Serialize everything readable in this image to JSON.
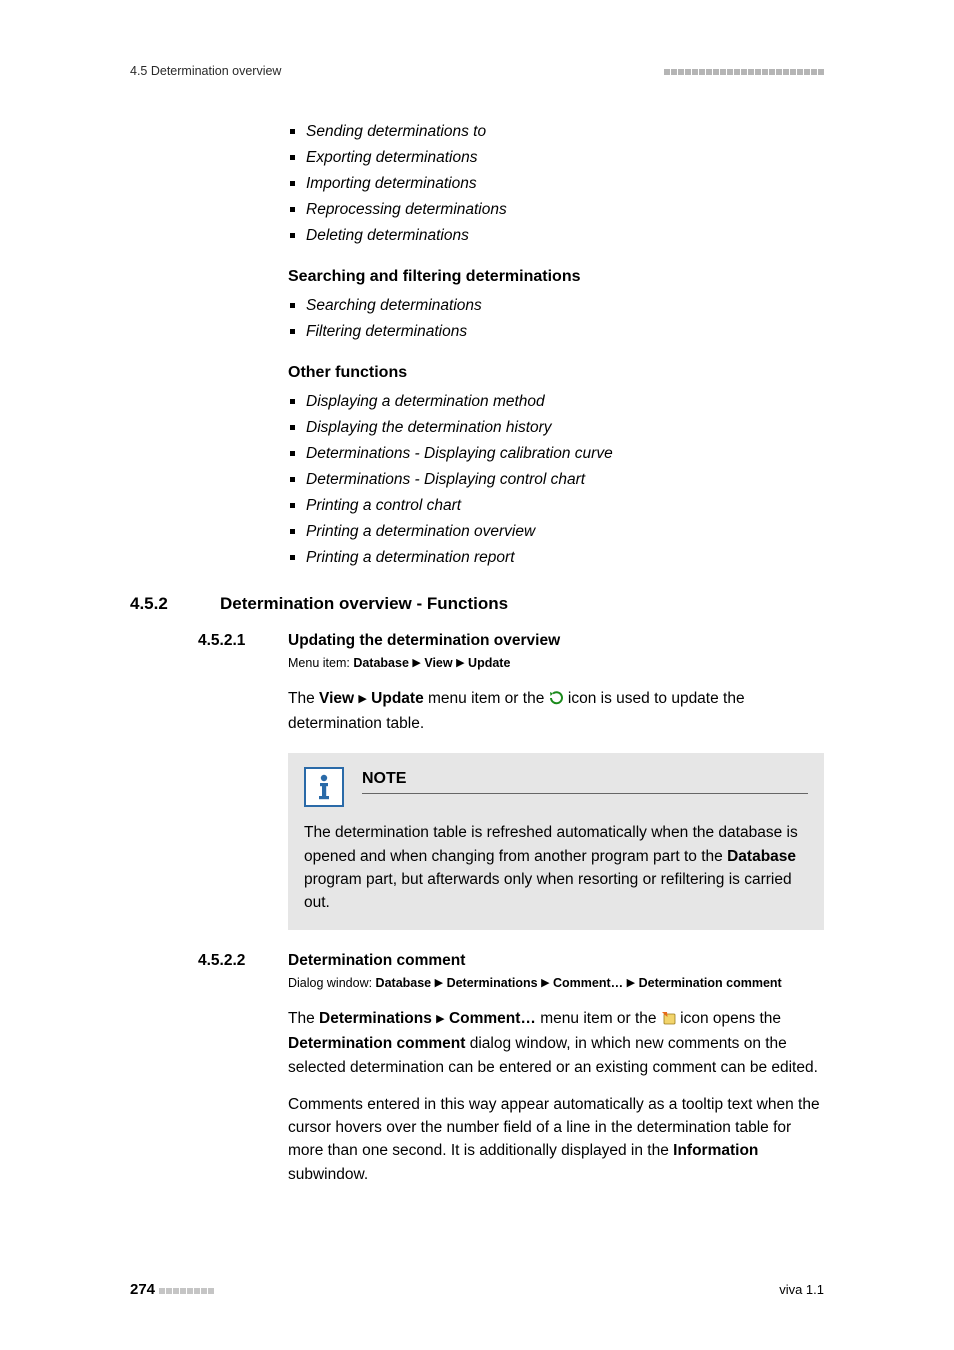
{
  "header": {
    "breadcrumb": "4.5 Determination overview"
  },
  "lists": {
    "first": [
      "Sending determinations to",
      "Exporting determinations",
      "Importing determinations",
      "Reprocessing determinations",
      "Deleting determinations"
    ],
    "search_heading": "Searching and filtering determinations",
    "search": [
      "Searching determinations",
      "Filtering determinations"
    ],
    "other_heading": "Other functions",
    "other": [
      "Displaying a determination method",
      "Displaying the determination history",
      "Determinations - Displaying calibration curve",
      "Determinations - Displaying control chart",
      "Printing a control chart",
      "Printing a determination overview",
      "Printing a determination report"
    ]
  },
  "sec": {
    "num": "4.5.2",
    "title": "Determination overview - Functions"
  },
  "sub1": {
    "num": "4.5.2.1",
    "title": "Updating the determination overview",
    "menu_prefix": "Menu item: ",
    "menu_1": "Database",
    "menu_2": "View",
    "menu_3": "Update",
    "p1_a": "The ",
    "p1_b": "View",
    "p1_c": "Update",
    "p1_d": " menu item or the ",
    "p1_e": " icon is used to update the determination table.",
    "note_label": "NOTE",
    "note_a": "The determination table is refreshed automatically when the database is opened and when changing from another program part to the ",
    "note_b": "Database",
    "note_c": " program part, but afterwards only when resorting or refiltering is carried out."
  },
  "sub2": {
    "num": "4.5.2.2",
    "title": "Determination comment",
    "dlg_prefix": "Dialog window: ",
    "dlg_1": "Database",
    "dlg_2": "Determinations",
    "dlg_3": "Comment…",
    "dlg_4": "Determination comment",
    "p1_a": "The ",
    "p1_b": "Determinations",
    "p1_c": "Comment…",
    "p1_d": " menu item or the ",
    "p1_e": " icon opens the ",
    "p1_f": "Determination comment",
    "p1_g": " dialog window, in which new comments on the selected determination can be entered or an existing comment can be edited.",
    "p2_a": "Comments entered in this way appear automatically as a tooltip text when the cursor hovers over the number field of a line in the determination table for more than one second. It is additionally displayed in the ",
    "p2_b": "Information",
    "p2_c": " subwindow."
  },
  "footer": {
    "page": "274",
    "product": "viva 1.1"
  }
}
